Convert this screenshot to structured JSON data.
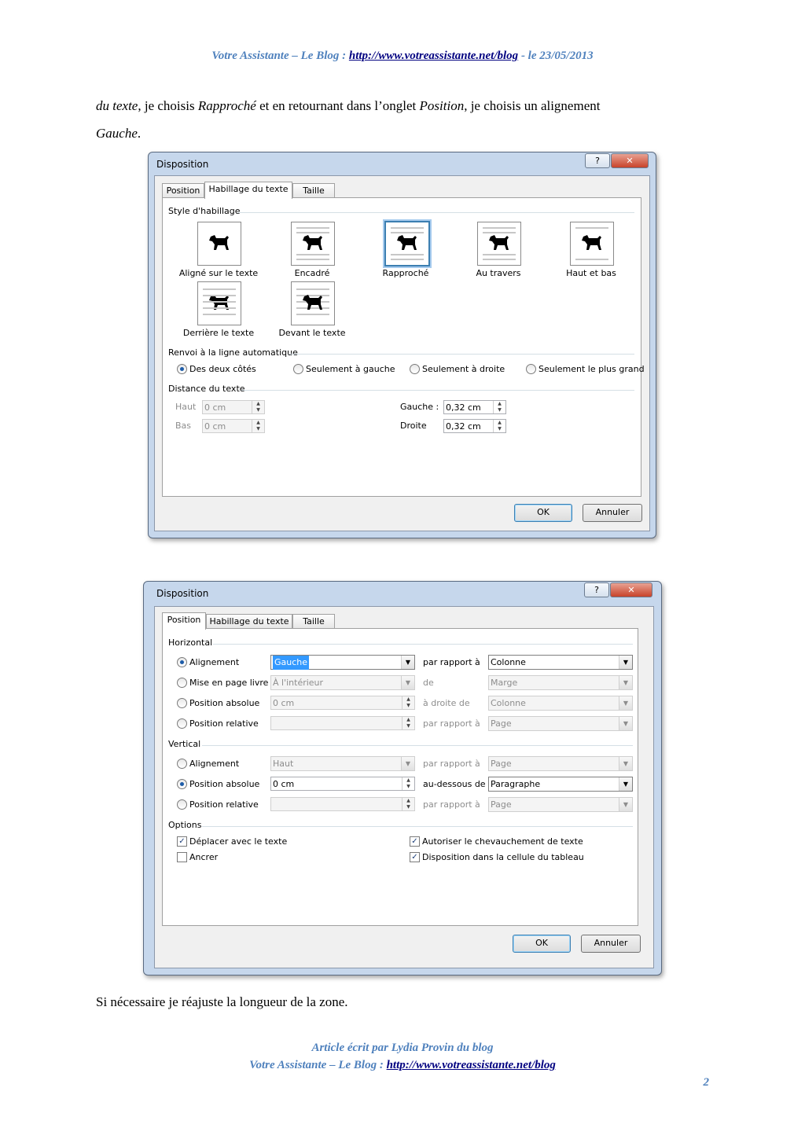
{
  "header": {
    "prefix": "Votre Assistante – Le Blog : ",
    "url": "http://www.votreassistante.net/blog",
    "date": " - le 23/05/2013"
  },
  "intro": {
    "t1": "du texte",
    "t2": ", je choisis ",
    "t3": "Rapproché",
    "t4": " et en retournant dans l’onglet ",
    "t5": "Position",
    "t6": ", je choisis un alignement",
    "t7": "Gauche",
    "t8": "."
  },
  "dialog1": {
    "title": "Disposition",
    "help": "?",
    "close": "✕",
    "tabs": [
      "Position",
      "Habillage du texte",
      "Taille"
    ],
    "section_style": "Style d'habillage",
    "styles": [
      "Aligné sur le texte",
      "Encadré",
      "Rapproché",
      "Au travers",
      "Haut et bas",
      "Derrière le texte",
      "Devant le texte"
    ],
    "section_renvoi": "Renvoi à la ligne automatique",
    "renvoi": [
      "Des deux côtés",
      "Seulement à gauche",
      "Seulement à droite",
      "Seulement le plus grand"
    ],
    "section_distance": "Distance du texte",
    "haut_label": "Haut",
    "haut_value": "0 cm",
    "bas_label": "Bas",
    "bas_value": "0 cm",
    "gauche_label": "Gauche :",
    "gauche_value": "0,32 cm",
    "droite_label": "Droite",
    "droite_value": "0,32 cm",
    "ok": "OK",
    "cancel": "Annuler"
  },
  "dialog2": {
    "title": "Disposition",
    "help": "?",
    "close": "✕",
    "tabs": [
      "Position",
      "Habillage du texte",
      "Taille"
    ],
    "section_h": "Horizontal",
    "h_rows": [
      {
        "label": "Alignement",
        "value": "Gauche",
        "rel": "par rapport à",
        "target": "Colonne"
      },
      {
        "label": "Mise en page livre",
        "value": "À l'intérieur",
        "rel": "de",
        "target": "Marge"
      },
      {
        "label": "Position absolue",
        "value": "0 cm",
        "rel": "à droite de",
        "target": "Colonne"
      },
      {
        "label": "Position relative",
        "value": "",
        "rel": "par rapport à",
        "target": "Page"
      }
    ],
    "section_v": "Vertical",
    "v_rows": [
      {
        "label": "Alignement",
        "value": "Haut",
        "rel": "par rapport à",
        "target": "Page"
      },
      {
        "label": "Position absolue",
        "value": "0 cm",
        "rel": "au-dessous de",
        "target": "Paragraphe"
      },
      {
        "label": "Position relative",
        "value": "",
        "rel": "par rapport à",
        "target": "Page"
      }
    ],
    "section_o": "Options",
    "options": [
      "Déplacer avec le texte",
      "Ancrer",
      "Autoriser le chevauchement de texte",
      "Disposition dans la cellule du tableau"
    ],
    "ok": "OK",
    "cancel": "Annuler"
  },
  "closing": "Si nécessaire je réajuste la longueur de la zone.",
  "footer": {
    "line1": "Article écrit par Lydia Provin du blog",
    "prefix": "Votre Assistante – Le Blog : ",
    "url": "http://www.votreassistante.net/blog"
  },
  "page_number": "2"
}
